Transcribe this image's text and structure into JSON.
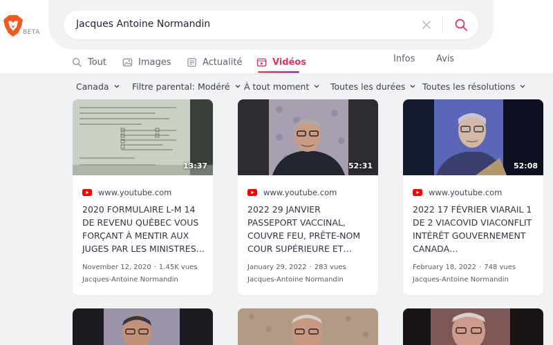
{
  "header": {
    "beta_label": "BETA",
    "search_value": "Jacques Antoine Normandin"
  },
  "tabs": [
    {
      "label": "Tout",
      "icon": "search-icon"
    },
    {
      "label": "Images",
      "icon": "image-icon"
    },
    {
      "label": "Actualité",
      "icon": "news-icon"
    },
    {
      "label": "Vidéos",
      "icon": "video-icon",
      "active": true
    }
  ],
  "side_links": {
    "infos": "Infos",
    "avis": "Avis"
  },
  "filters": [
    "Canada",
    "Filtre parental: Modéré",
    "À tout moment",
    "Toutes les durées",
    "Toutes les résolutions"
  ],
  "colors": {
    "accent": "#e0345b",
    "youtube": "#ff0000",
    "page_bg": "#f1f2f4"
  },
  "videos": [
    {
      "duration": "13:37",
      "source": "www.youtube.com",
      "title": "2020 FORMULAIRE L-M 14 DE REVENU QUÉBEC VOUS FORÇANT À MENTIR AUX JUGES PAR LES MINISTRES…",
      "date": "November 12, 2020",
      "views": "1.45K vues",
      "author": "Jacques-Antoine Normandin"
    },
    {
      "duration": "52:31",
      "source": "www.youtube.com",
      "title": "2022 29 JANVIER PASSEPORT VACCINAL, COUVRE FEU, PRÊTE-NOM COUR SUPÉRIEURE ET…",
      "date": "January 29, 2022",
      "views": "283 vues",
      "author": "Jacques-Antoine Normandin"
    },
    {
      "duration": "52:08",
      "source": "www.youtube.com",
      "title": "2022 17 FÉVRIER VIARAIL 1 DE 2 VIACOVID VIACONFLIT INTÉRÊT GOUVERNEMENT CANADA…",
      "date": "February 18, 2022",
      "views": "748 vues",
      "author": "Jacques-Antoine Normandin"
    }
  ]
}
